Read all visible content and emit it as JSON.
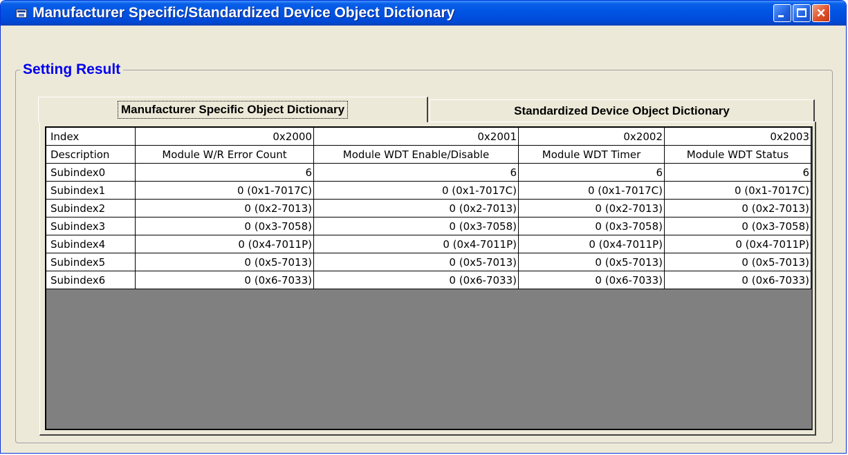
{
  "window": {
    "title": "Manufacturer Specific/Standardized Device Object Dictionary",
    "controls": {
      "minimize": "minimize",
      "maximize": "maximize",
      "close": "×"
    }
  },
  "group": {
    "caption": "Setting Result"
  },
  "tabs": [
    {
      "label": "Manufacturer Specific Object Dictionary",
      "active": true
    },
    {
      "label": "Standardized Device Object Dictionary",
      "active": false
    }
  ],
  "grid": {
    "rows": [
      [
        "Index",
        "0x2000",
        "0x2001",
        "0x2002",
        "0x2003"
      ],
      [
        "Description",
        "Module W/R Error Count",
        "Module WDT Enable/Disable",
        "Module WDT Timer",
        "Module WDT Status"
      ],
      [
        "Subindex0",
        "6",
        "6",
        "6",
        "6"
      ],
      [
        "Subindex1",
        "0 (0x1-7017C)",
        "0 (0x1-7017C)",
        "0 (0x1-7017C)",
        "0 (0x1-7017C)"
      ],
      [
        "Subindex2",
        "0 (0x2-7013)",
        "0 (0x2-7013)",
        "0 (0x2-7013)",
        "0 (0x2-7013)"
      ],
      [
        "Subindex3",
        "0 (0x3-7058)",
        "0 (0x3-7058)",
        "0 (0x3-7058)",
        "0 (0x3-7058)"
      ],
      [
        "Subindex4",
        "0 (0x4-7011P)",
        "0 (0x4-7011P)",
        "0 (0x4-7011P)",
        "0 (0x4-7011P)"
      ],
      [
        "Subindex5",
        "0 (0x5-7013)",
        "0 (0x5-7013)",
        "0 (0x5-7013)",
        "0 (0x5-7013)"
      ],
      [
        "Subindex6",
        "0 (0x6-7033)",
        "0 (0x6-7033)",
        "0 (0x6-7033)",
        "0 (0x6-7033)"
      ]
    ]
  },
  "colors": {
    "titlebar": "#0054e3",
    "caption_text": "#0000ee",
    "window_face": "#ece9d8",
    "grid_empty": "#808080",
    "close_button": "#e0522a"
  },
  "icons": [
    "app-window-icon",
    "minimize-icon",
    "maximize-icon",
    "close-icon"
  ]
}
